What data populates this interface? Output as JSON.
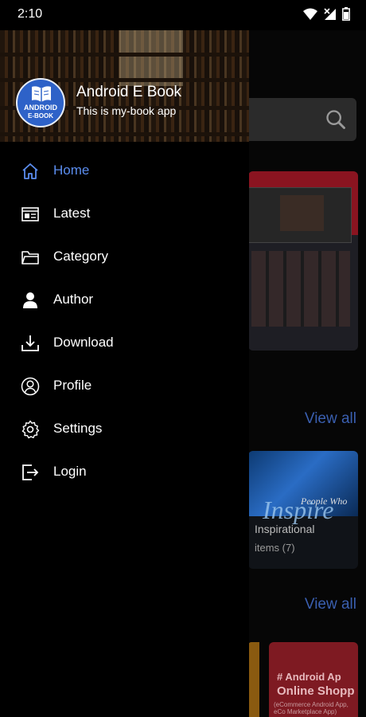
{
  "status_bar": {
    "time": "2:10"
  },
  "drawer": {
    "app_name": "Android E Book",
    "tagline": "This is my-book app",
    "logo": {
      "line1": "ANDROID",
      "line2": "E-BOOK"
    },
    "menu": [
      {
        "label": "Home",
        "icon": "home-icon",
        "active": true
      },
      {
        "label": "Latest",
        "icon": "newspaper-icon",
        "active": false
      },
      {
        "label": "Category",
        "icon": "folder-icon",
        "active": false
      },
      {
        "label": "Author",
        "icon": "person-icon",
        "active": false
      },
      {
        "label": "Download",
        "icon": "download-icon",
        "active": false
      },
      {
        "label": "Profile",
        "icon": "profile-circle-icon",
        "active": false
      },
      {
        "label": "Settings",
        "icon": "gear-icon",
        "active": false
      },
      {
        "label": "Login",
        "icon": "login-icon",
        "active": false
      }
    ]
  },
  "background": {
    "view_all_1": "View all",
    "view_all_2": "View all",
    "category_card": {
      "name": "Inspirational",
      "items": "items (7)",
      "image_text": "People Who",
      "image_title": "Inspire"
    },
    "promo_card": {
      "line1": "# Android Ap",
      "line2": "Online Shopp",
      "line3": "(eCommerce Android App, eCo Marketplace App)"
    }
  },
  "colors": {
    "accent": "#5b8def",
    "background": "#000000",
    "text": "#ffffff"
  }
}
